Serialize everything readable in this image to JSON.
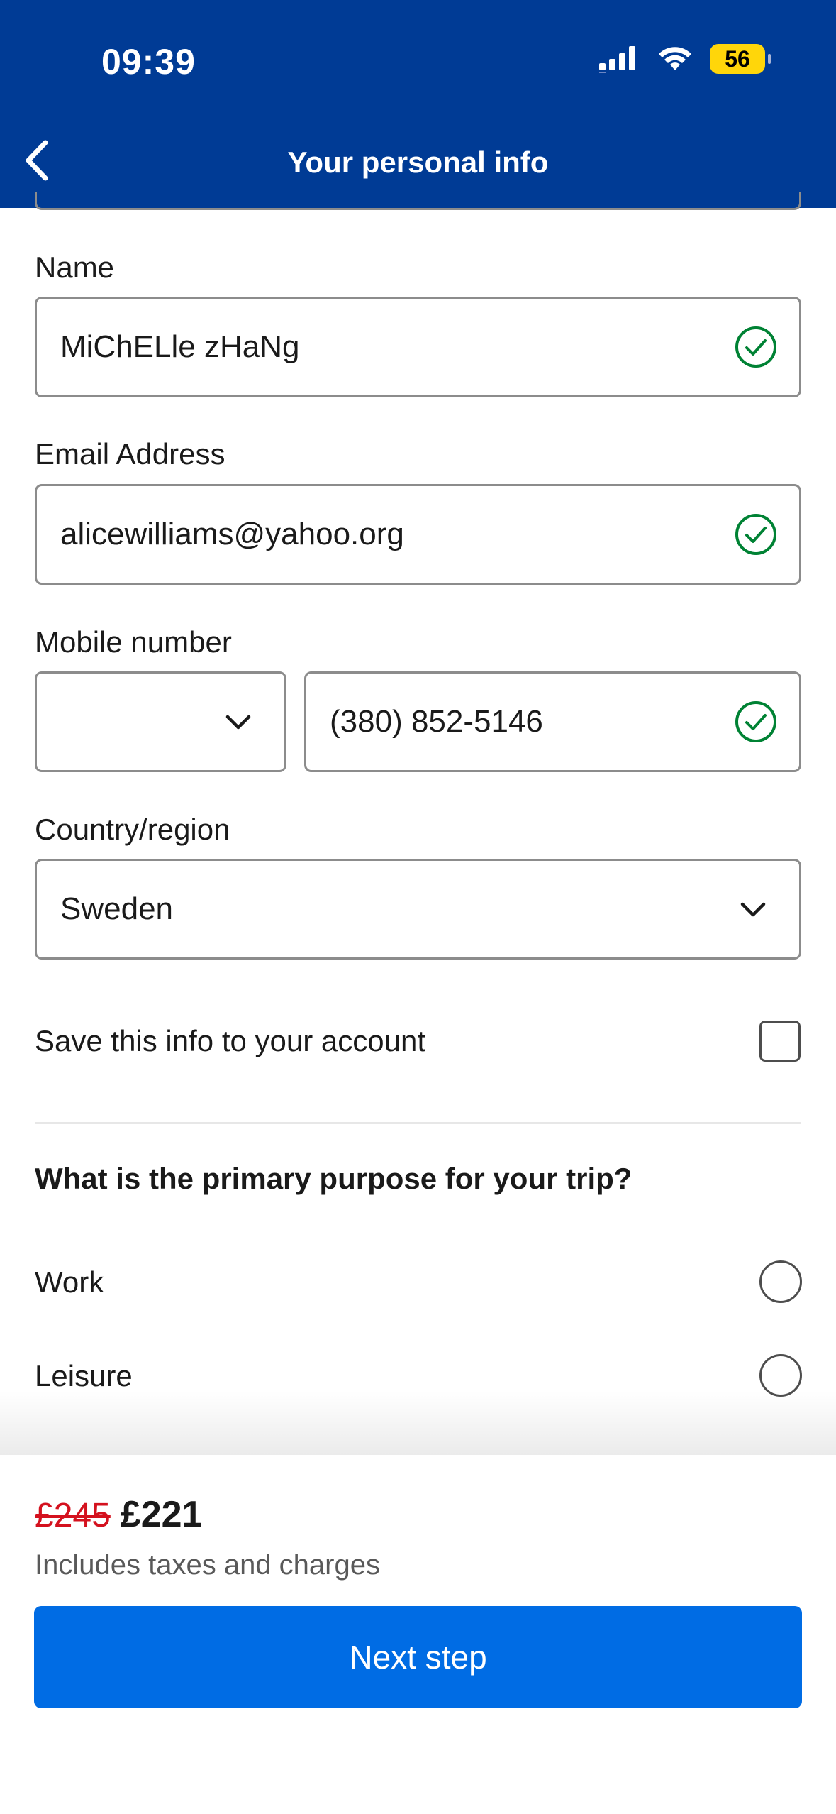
{
  "status_bar": {
    "time": "09:39",
    "battery": "56"
  },
  "header": {
    "title": "Your personal info"
  },
  "form": {
    "name": {
      "label": "Name",
      "value": "MiChELle zHaNg"
    },
    "email": {
      "label": "Email Address",
      "value": "alicewilliams@yahoo.org"
    },
    "mobile": {
      "label": "Mobile number",
      "country_code": "",
      "value": "(380) 852-5146"
    },
    "country": {
      "label": "Country/region",
      "value": "Sweden"
    },
    "save_info": {
      "label": "Save this info to your account",
      "checked": false
    }
  },
  "trip_purpose": {
    "question": "What is the primary purpose for your trip?",
    "options": [
      {
        "label": "Work",
        "selected": false
      },
      {
        "label": "Leisure",
        "selected": false
      }
    ]
  },
  "footer": {
    "old_price": "£245",
    "new_price": "£221",
    "note": "Includes taxes and charges",
    "next_label": "Next step"
  },
  "colors": {
    "header_bg": "#003b95",
    "primary_button": "#006ce4",
    "valid_check": "#008234",
    "strikethrough_price": "#d4111e",
    "battery": "#ffd60a"
  }
}
